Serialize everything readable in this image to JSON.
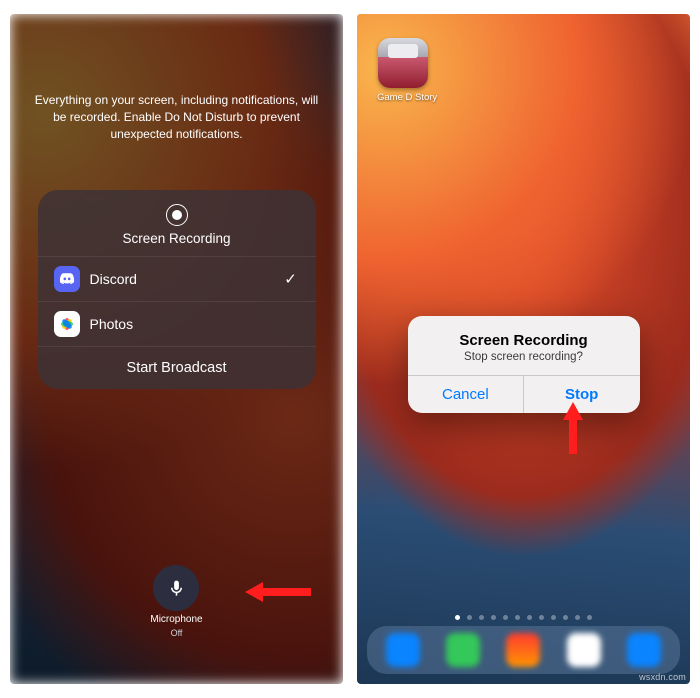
{
  "left": {
    "help_text": "Everything on your screen, including notifications, will be recorded. Enable Do Not Disturb to prevent unexpected notifications.",
    "card": {
      "title": "Screen Recording",
      "options": [
        {
          "label": "Discord",
          "selected": "✓"
        },
        {
          "label": "Photos",
          "selected": ""
        }
      ],
      "primary_action": "Start Broadcast"
    },
    "mic": {
      "label": "Microphone",
      "state": "Off"
    }
  },
  "right": {
    "app_icon": {
      "label": "Game D Story"
    },
    "alert": {
      "title": "Screen Recording",
      "message": "Stop screen recording?",
      "cancel": "Cancel",
      "confirm": "Stop"
    },
    "page_indicator": {
      "count": 12,
      "active_index": 0
    }
  },
  "watermark": "wsxdn.com"
}
